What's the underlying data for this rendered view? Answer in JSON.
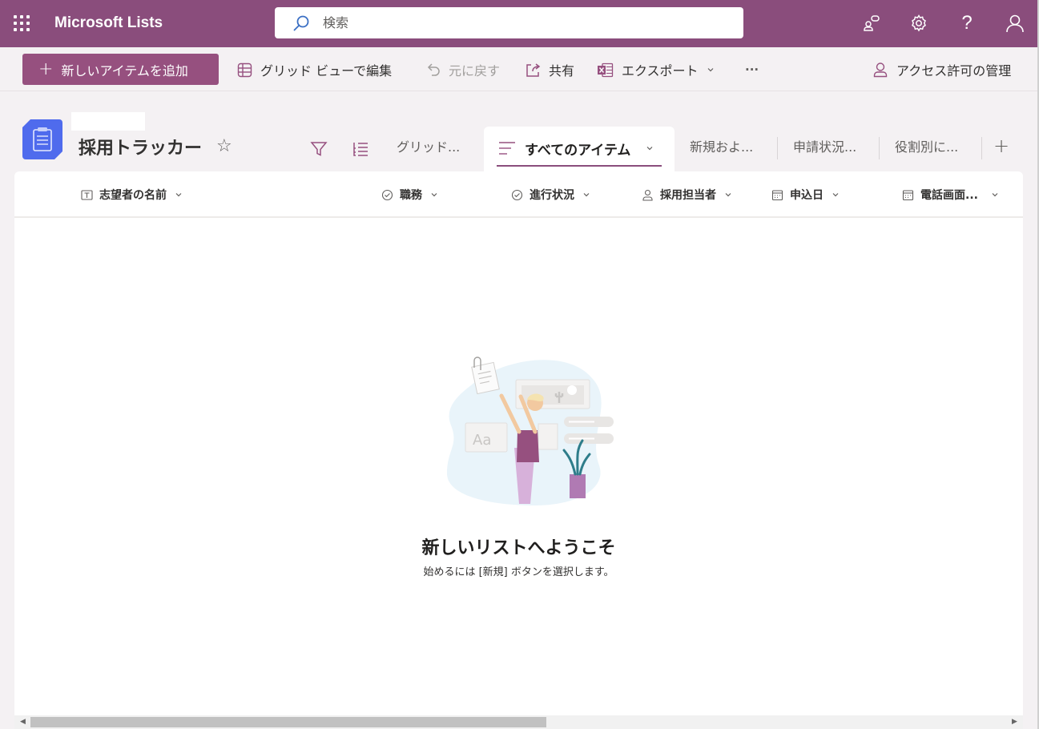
{
  "suite": {
    "app_title": "Microsoft Lists",
    "search_placeholder": "検索",
    "icons": [
      "waffle-icon",
      "share-people-icon",
      "gear-icon",
      "help-icon",
      "account-icon"
    ]
  },
  "commands": {
    "new_item": "新しいアイテムを追加",
    "grid_edit": "グリッド ビューで編集",
    "undo": "元に戻す",
    "share": "共有",
    "export": "エクスポート",
    "more": "···",
    "manage_access": "アクセス許可の管理"
  },
  "list": {
    "title": "採用トラッカー",
    "star": "☆"
  },
  "tabs": {
    "grid": "グリッド...",
    "active": "すべてのアイテム",
    "new": "新規およ...",
    "status": "申請状況...",
    "role": "役割別に...",
    "add": "+"
  },
  "columns": [
    {
      "label": "志望者の名前",
      "icon": "text-icon"
    },
    {
      "label": "職務",
      "icon": "choice-icon"
    },
    {
      "label": "進行状況",
      "icon": "choice-icon"
    },
    {
      "label": "採用担当者",
      "icon": "person-icon"
    },
    {
      "label": "申込日",
      "icon": "calendar-icon"
    },
    {
      "label": "電話画面...",
      "icon": "calendar-icon"
    }
  ],
  "empty_state": {
    "title": "新しいリストへようこそ",
    "subtitle": "始めるには [新規] ボタンを選択します。",
    "illustration_text": "Aa"
  },
  "colors": {
    "brand": "#8a4d7c",
    "button": "#96507f",
    "page_bg": "#f4f1f3",
    "list_icon": "#4f6bed"
  }
}
